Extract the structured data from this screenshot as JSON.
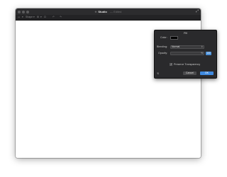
{
  "window": {
    "app_icon": "⟡",
    "document_name": "Studio",
    "document_status": "— Edited"
  },
  "toolbar": {
    "items": [
      "▭",
      "▾",
      "Shape",
      "▾",
      "⊞",
      "▾",
      "⊡",
      "↶",
      "↷"
    ]
  },
  "fill_dialog": {
    "title": "Fill",
    "color_label": "Color:",
    "color_value": "#000000",
    "blending_label": "Blending:",
    "blending_value": "Normal",
    "opacity_label": "Opacity:",
    "opacity_unit": "%",
    "opacity_value": "100",
    "preserve_label": "Preserve Transparency",
    "preserve_checked": true,
    "cancel_label": "Cancel",
    "ok_label": "OK"
  },
  "colors": {
    "accent": "#3f8ae0",
    "titlebar": "#2c2c2e",
    "dialog_bg": "#2a2a2c"
  },
  "icons": {
    "window_close": "traffic-light-close-icon",
    "window_minimize": "traffic-light-minimize-icon",
    "window_zoom": "traffic-light-zoom-icon",
    "fullscreen": "fullscreen-arrows-icon",
    "help": "help-icon",
    "select_arrows": "select-arrows-icon"
  }
}
